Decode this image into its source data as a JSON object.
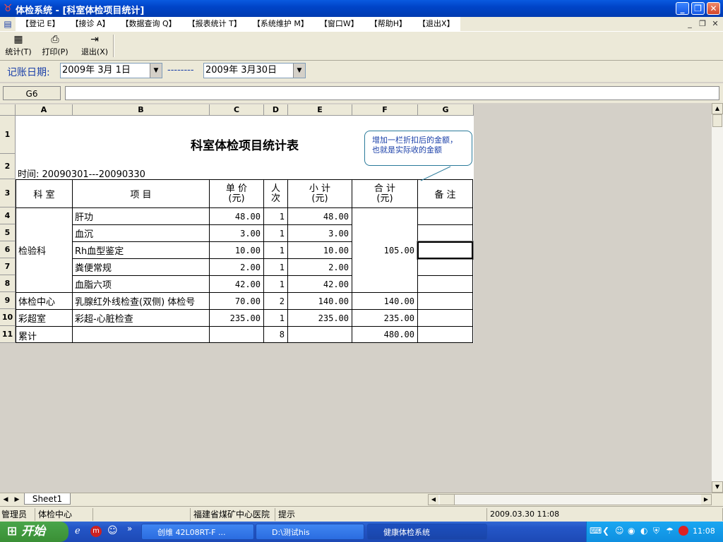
{
  "window": {
    "title": "体检系统 - [科室体检项目统计]",
    "icon": "app-icon",
    "min": "_",
    "max": "❐",
    "close": "✕"
  },
  "menu": [
    "【登记 E】",
    "【接诊 A】",
    "【数据查询 Q】",
    "【报表统计 T】",
    "【系统维护 M】",
    "【窗口W】",
    "【帮助H】",
    "【退出X】"
  ],
  "toolbar": {
    "stat": "统计(T)",
    "print": "打印(P)",
    "exit": "退出(X)"
  },
  "dates": {
    "label": "记账日期:",
    "from": "2009年 3月 1日",
    "sep": "--------",
    "to": "2009年 3月30日"
  },
  "formula": {
    "cellref": "G6",
    "value": ""
  },
  "columns": [
    "A",
    "B",
    "C",
    "D",
    "E",
    "F",
    "G"
  ],
  "rows": [
    "1",
    "2",
    "3",
    "4",
    "5",
    "6",
    "7",
    "8",
    "9",
    "10",
    "11"
  ],
  "report": {
    "title": "科室体检项目统计表",
    "period": "时间: 20090301---20090330",
    "headers": {
      "dept": "科  室",
      "item": "项    目",
      "price1": "单 价",
      "price2": "(元)",
      "count1": "人",
      "count2": "次",
      "sub1": "小 计",
      "sub2": "(元)",
      "total1": "合 计",
      "total2": "(元)",
      "note": "备 注"
    },
    "lines": [
      {
        "dept": "检验科",
        "item": "肝功",
        "price": "48.00",
        "count": "1",
        "subtotal": "48.00"
      },
      {
        "item": "血沉",
        "price": "3.00",
        "count": "1",
        "subtotal": "3.00"
      },
      {
        "item": "Rh血型鉴定",
        "price": "10.00",
        "count": "1",
        "subtotal": "10.00"
      },
      {
        "item": "粪便常规",
        "price": "2.00",
        "count": "1",
        "subtotal": "2.00"
      },
      {
        "item": "血脂六项",
        "price": "42.00",
        "count": "1",
        "subtotal": "42.00"
      },
      {
        "dept": "体检中心",
        "item": "乳腺红外线检查(双侧) 体检号",
        "price": "70.00",
        "count": "2",
        "subtotal": "140.00",
        "total": "140.00"
      },
      {
        "dept": "彩超室",
        "item": "彩超-心脏检查",
        "price": "235.00",
        "count": "1",
        "subtotal": "235.00",
        "total": "235.00"
      }
    ],
    "lab_total": "105.00",
    "sum_label": "累计",
    "sum_count": "8",
    "sum_total": "480.00"
  },
  "callout": "增加一栏折扣后的金额，也就是实际收的金额",
  "sheet_tab": "Sheet1",
  "status": {
    "user": "管理员",
    "dept": "体检中心",
    "hospital": "福建省煤矿中心医院",
    "hint": "提示",
    "datetime": "2009.03.30 11:08"
  },
  "taskbar": {
    "start": "开始",
    "tasks": [
      "创维 42L08RT-F ...",
      "D:\\测试his",
      "健康体检系统"
    ],
    "clock": "11:08"
  }
}
